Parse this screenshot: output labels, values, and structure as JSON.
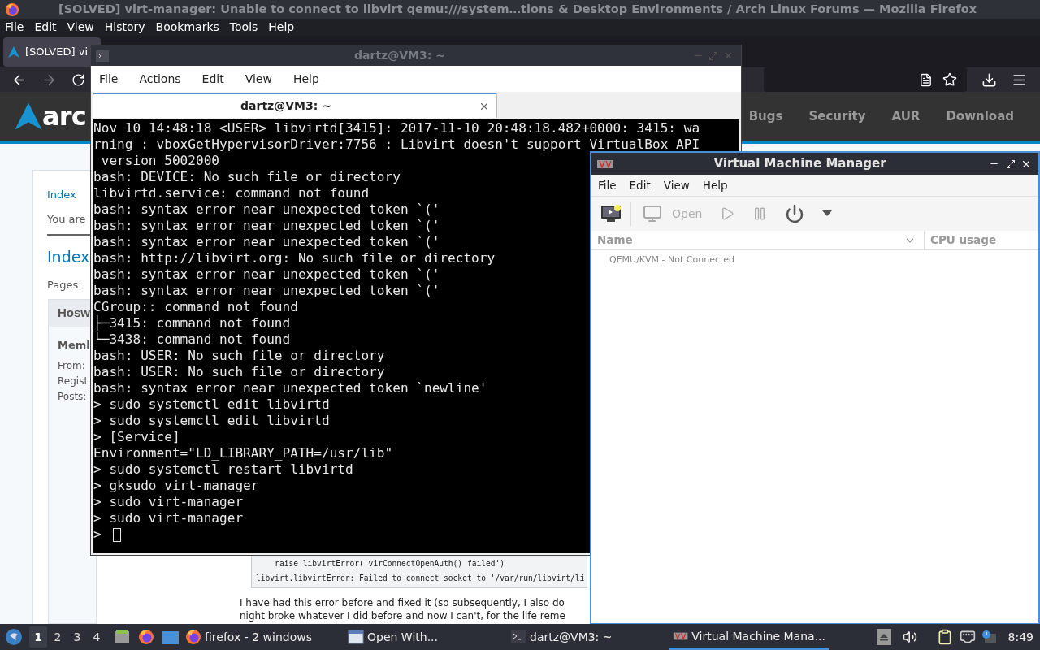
{
  "firefox": {
    "title": "[SOLVED] virt-manager: Unable to connect to libvirt qemu:///system…tions & Desktop Environments / Arch Linux Forums — Mozilla Firefox",
    "menu": [
      "File",
      "Edit",
      "View",
      "History",
      "Bookmarks",
      "Tools",
      "Help"
    ],
    "tab": {
      "label": "[SOLVED] vi",
      "selected": true
    },
    "page": {
      "logo": "arc",
      "nav": [
        "Bugs",
        "Security",
        "AUR",
        "Download"
      ],
      "breadcrumb": "Index",
      "notice": "You are",
      "heading": "Index",
      "pages": "Pages:",
      "post": {
        "author": "Hosw",
        "rank": "Meml",
        "fields": [
          "From:",
          "Regist",
          "Posts:"
        ]
      },
      "code": [
        "raise libvirtError('virConnectOpenAuth() failed')",
        "libvirt.libvirtError: Failed to connect socket to '/var/run/libvirt/li"
      ],
      "paragraph": [
        "I have had this error before and fixed it (so subsequently, I also do",
        "night broke whatever I did before and now I can't, for the life reme"
      ]
    }
  },
  "terminal": {
    "title": "dartz@VM3: ~",
    "menu": [
      "File",
      "Actions",
      "Edit",
      "View",
      "Help"
    ],
    "tab": {
      "label": "dartz@VM3: ~",
      "selected": true
    },
    "lines": [
      "Nov 10 14:48:18 <USER> libvirtd[3415]: 2017-11-10 20:48:18.482+0000: 3415: wa",
      "rning : vboxGetHypervisorDriver:7756 : Libvirt doesn't support VirtualBox API",
      " version 5002000",
      "bash: DEVICE: No such file or directory",
      "libvirtd.service: command not found",
      "bash: syntax error near unexpected token `('",
      "bash: syntax error near unexpected token `('",
      "bash: syntax error near unexpected token `('",
      "bash: http://libvirt.org: No such file or directory",
      "bash: syntax error near unexpected token `('",
      "bash: syntax error near unexpected token `('",
      "CGroup:: command not found",
      "├─3415: command not found",
      "└─3438: command not found",
      "bash: USER: No such file or directory",
      "bash: USER: No such file or directory",
      "bash: syntax error near unexpected token `newline'",
      "> sudo systemctl edit libvirtd",
      "> sudo systemctl edit libvirtd",
      "> [Service]",
      "Environment=\"LD_LIBRARY_PATH=/usr/lib\"",
      "> sudo systemctl restart libvirtd",
      "> gksudo virt-manager",
      "> sudo virt-manager",
      "> sudo virt-manager"
    ],
    "prompt": ">"
  },
  "vmm": {
    "title": "Virtual Machine Manager",
    "menu": [
      "File",
      "Edit",
      "View",
      "Help"
    ],
    "toolbar": [
      {
        "kind": "new",
        "disabled": false
      },
      {
        "kind": "open",
        "label": "Open",
        "disabled": true
      },
      {
        "kind": "run",
        "disabled": true
      },
      {
        "kind": "pause",
        "disabled": true
      },
      {
        "kind": "power",
        "disabled": false
      },
      {
        "kind": "dropdown",
        "disabled": false
      }
    ],
    "columns": [
      "Name",
      "CPU usage"
    ],
    "rows": [
      "QEMU/KVM - Not Connected"
    ]
  },
  "taskbar": {
    "workspaces": [
      {
        "label": "1",
        "selected": true
      },
      {
        "label": "2",
        "selected": false
      },
      {
        "label": "3",
        "selected": false
      },
      {
        "label": "4",
        "selected": false
      }
    ],
    "tasks": [
      {
        "kind": "firefox",
        "label": "firefox - 2 windows",
        "selected": false
      },
      {
        "kind": "window",
        "label": "Open With...",
        "selected": false
      },
      {
        "kind": "terminal",
        "label": "dartz@VM3: ~",
        "selected": false
      },
      {
        "kind": "vmm",
        "label": "Virtual Machine Mana...",
        "selected": true
      }
    ],
    "clock": "8:49"
  }
}
